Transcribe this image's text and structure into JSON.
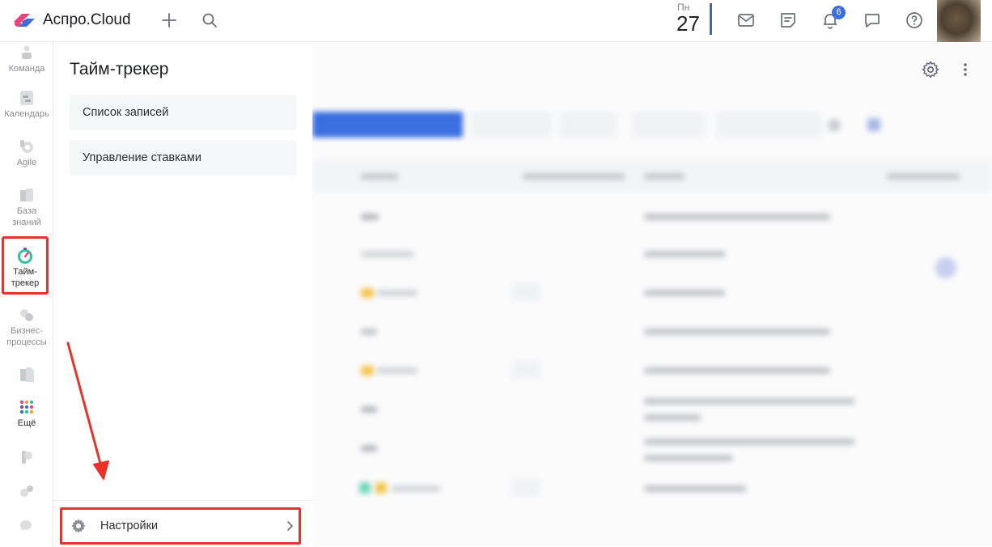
{
  "topbar": {
    "brand": "Аспро.Cloud",
    "date_dow": "Пн",
    "date_day": "27",
    "notifications_count": "6",
    "icons": [
      "plus-icon",
      "search-icon",
      "mail-icon",
      "notes-icon",
      "bell-icon",
      "chat-icon",
      "help-icon"
    ]
  },
  "rail": {
    "items": [
      {
        "label": "Команда",
        "icon": "team-icon"
      },
      {
        "label": "Календарь",
        "icon": "calendar-icon"
      },
      {
        "label": "Agile",
        "icon": "agile-icon"
      },
      {
        "label": "База знаний",
        "icon": "knowledge-base-icon"
      },
      {
        "label": "Тайм-трекер",
        "icon": "time-tracker-icon"
      },
      {
        "label": "Бизнес-процессы",
        "icon": "business-process-icon"
      },
      {
        "label": "Ещё",
        "icon": "more-apps-icon"
      }
    ]
  },
  "panel": {
    "title": "Тайм-трекер",
    "menu": [
      {
        "label": "Список записей"
      },
      {
        "label": "Управление ставками"
      }
    ],
    "settings_label": "Настройки"
  },
  "colors": {
    "accent": "#3b6fe0",
    "highlight": "#e8332a",
    "time_tracker_green": "#2ec4a0"
  }
}
